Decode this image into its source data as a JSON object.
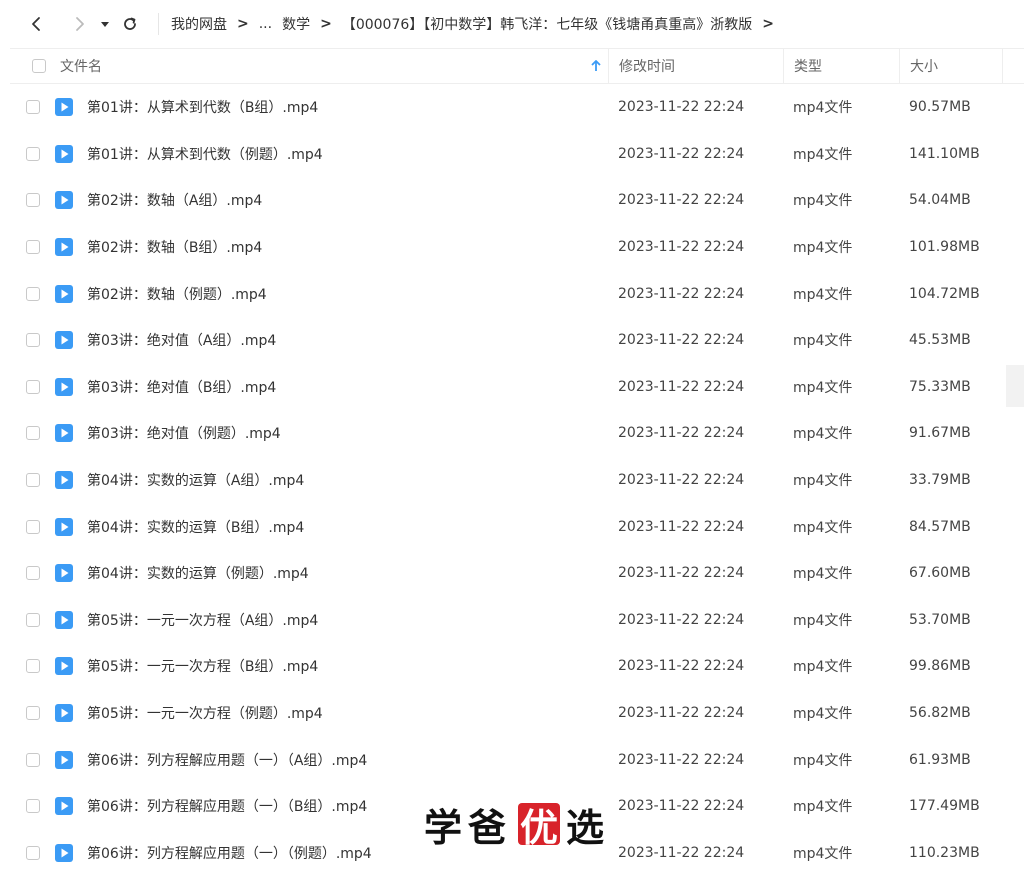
{
  "breadcrumb": [
    {
      "label": "我的网盘"
    },
    {
      "label": "..."
    },
    {
      "label": "数学"
    },
    {
      "label": "【000076】【初中数学】韩飞洋：七年级《钱塘甬真重高》浙教版"
    }
  ],
  "header": {
    "name": "文件名",
    "time": "修改时间",
    "type": "类型",
    "size": "大小"
  },
  "files": [
    {
      "name": "第01讲：从算术到代数（B组）.mp4",
      "time": "2023-11-22 22:24",
      "type": "mp4文件",
      "size": "90.57MB"
    },
    {
      "name": "第01讲：从算术到代数（例题）.mp4",
      "time": "2023-11-22 22:24",
      "type": "mp4文件",
      "size": "141.10MB"
    },
    {
      "name": "第02讲：数轴（A组）.mp4",
      "time": "2023-11-22 22:24",
      "type": "mp4文件",
      "size": "54.04MB"
    },
    {
      "name": "第02讲：数轴（B组）.mp4",
      "time": "2023-11-22 22:24",
      "type": "mp4文件",
      "size": "101.98MB"
    },
    {
      "name": "第02讲：数轴（例题）.mp4",
      "time": "2023-11-22 22:24",
      "type": "mp4文件",
      "size": "104.72MB"
    },
    {
      "name": "第03讲：绝对值（A组）.mp4",
      "time": "2023-11-22 22:24",
      "type": "mp4文件",
      "size": "45.53MB"
    },
    {
      "name": "第03讲：绝对值（B组）.mp4",
      "time": "2023-11-22 22:24",
      "type": "mp4文件",
      "size": "75.33MB"
    },
    {
      "name": "第03讲：绝对值（例题）.mp4",
      "time": "2023-11-22 22:24",
      "type": "mp4文件",
      "size": "91.67MB"
    },
    {
      "name": "第04讲：实数的运算（A组）.mp4",
      "time": "2023-11-22 22:24",
      "type": "mp4文件",
      "size": "33.79MB"
    },
    {
      "name": "第04讲：实数的运算（B组）.mp4",
      "time": "2023-11-22 22:24",
      "type": "mp4文件",
      "size": "84.57MB"
    },
    {
      "name": "第04讲：实数的运算（例题）.mp4",
      "time": "2023-11-22 22:24",
      "type": "mp4文件",
      "size": "67.60MB"
    },
    {
      "name": "第05讲：一元一次方程（A组）.mp4",
      "time": "2023-11-22 22:24",
      "type": "mp4文件",
      "size": "53.70MB"
    },
    {
      "name": "第05讲：一元一次方程（B组）.mp4",
      "time": "2023-11-22 22:24",
      "type": "mp4文件",
      "size": "99.86MB"
    },
    {
      "name": "第05讲：一元一次方程（例题）.mp4",
      "time": "2023-11-22 22:24",
      "type": "mp4文件",
      "size": "56.82MB"
    },
    {
      "name": "第06讲：列方程解应用题（一）（A组）.mp4",
      "time": "2023-11-22 22:24",
      "type": "mp4文件",
      "size": "61.93MB"
    },
    {
      "name": "第06讲：列方程解应用题（一）（B组）.mp4",
      "time": "2023-11-22 22:24",
      "type": "mp4文件",
      "size": "177.49MB"
    },
    {
      "name": "第06讲：列方程解应用题（一）（例题）.mp4",
      "time": "2023-11-22 22:24",
      "type": "mp4文件",
      "size": "110.23MB"
    }
  ],
  "watermark": {
    "part1": "学爸",
    "badge": "优",
    "part2": "选"
  },
  "colors": {
    "accent": "#3b9bf5",
    "badge": "#d8232a"
  }
}
